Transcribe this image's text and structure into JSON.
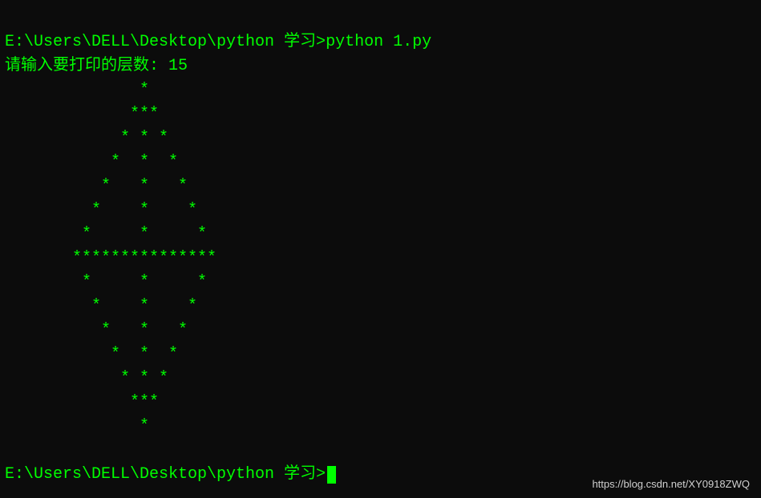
{
  "terminal": {
    "prompt1_path": "E:\\Users\\DELL\\Desktop\\python 学习>",
    "prompt1_command": "python 1.py",
    "input_prompt": "请输入要打印的层数: 15",
    "output_lines": [
      "              *",
      "             ***",
      "            * * *",
      "           *  *  *",
      "          *   *   *",
      "         *    *    *",
      "        *     *     *",
      "       ***************",
      "        *     *     *",
      "         *    *    *",
      "          *   *   *",
      "           *  *  *",
      "            * * *",
      "             ***",
      "              *"
    ],
    "prompt2_path": "E:\\Users\\DELL\\Desktop\\python 学习>"
  },
  "watermark": "https://blog.csdn.net/XY0918ZWQ"
}
